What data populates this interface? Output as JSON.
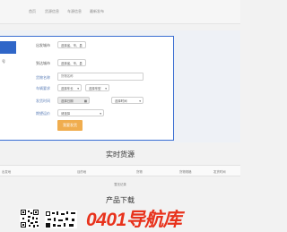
{
  "nav": {
    "items": [
      "首页",
      "货源信息",
      "车源信息",
      "最新发布"
    ]
  },
  "form": {
    "origin_label": "出发城市",
    "origin_value": "选择省、市、县",
    "dest_label": "到达城市",
    "dest_value": "选择省、市、县",
    "cargo_name_label": "货物名称",
    "cargo_name_placeholder": "货物名称",
    "vehicle_label": "车辆要求",
    "vehicle_length": "选择车长",
    "vehicle_type": "选择车型",
    "ship_time_label": "发货时间",
    "ship_time_value": "选择日期",
    "ship_time_period": "选择时间",
    "freight_label": "期望运价",
    "freight_value": "请选择",
    "submit": "我要发货",
    "side_text": "号"
  },
  "realtime": {
    "title": "实时货源",
    "columns": [
      "出发地",
      "目的地",
      "货物",
      "货物规格",
      "发货时间"
    ],
    "empty_text": "暂无记录"
  },
  "download": {
    "title": "产品下载"
  },
  "watermark": "0401导航库"
}
